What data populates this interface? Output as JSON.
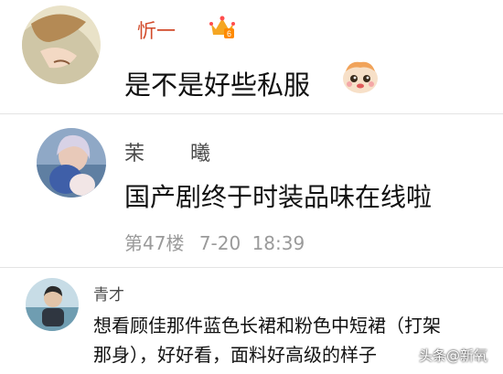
{
  "comments": [
    {
      "username": "忻一",
      "text": "是不是好些私服",
      "badge_icon": "crown-badge-icon",
      "emoji_icon": "cartoon-cute-emoji-icon"
    },
    {
      "username": "茉　　曦",
      "text": "国产剧终于时装品味在线啦",
      "floor_label": "第47楼",
      "date": "7-20",
      "time": "18:39"
    },
    {
      "username": "青才",
      "text_line1": "想看顾佳那件蓝色长裙和粉色中短裙（打架",
      "text_line2": "那身），好好看，面料好高级的样子"
    }
  ],
  "watermark": {
    "platform": "头条",
    "account": "@新氧"
  },
  "colors": {
    "crown": "#f5a623",
    "badge_orange": "#ff8a00",
    "divider": "#e4e4e4"
  }
}
